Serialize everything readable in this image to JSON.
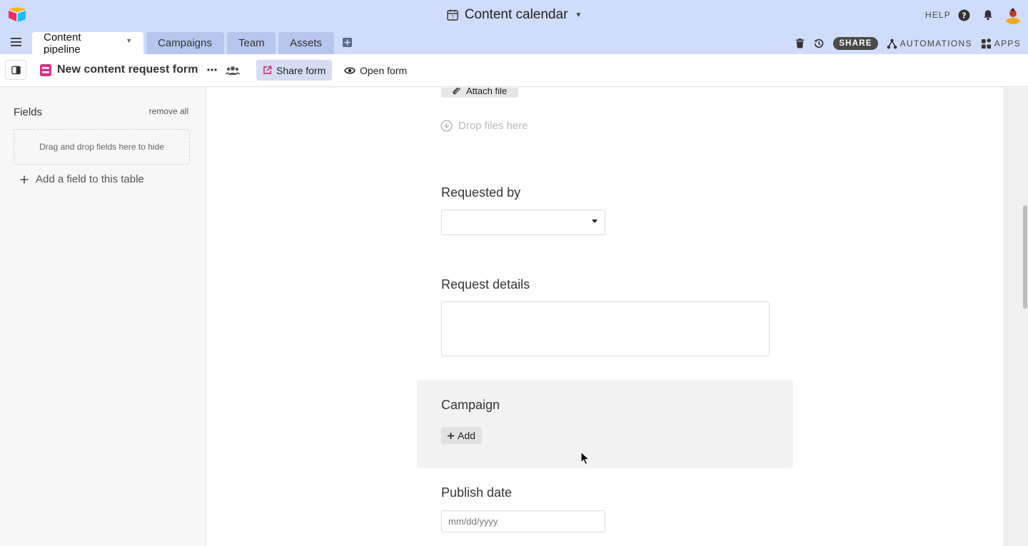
{
  "header": {
    "base_title": "Content calendar",
    "help_label": "HELP",
    "title_icon": "calendar-icon"
  },
  "tabs": [
    {
      "label": "Content pipeline",
      "active": true
    },
    {
      "label": "Campaigns",
      "active": false
    },
    {
      "label": "Team",
      "active": false
    },
    {
      "label": "Assets",
      "active": false
    }
  ],
  "toolbar": {
    "share_label": "SHARE",
    "automations_label": "AUTOMATIONS",
    "apps_label": "APPS"
  },
  "viewbar": {
    "view_name": "New content request form",
    "share_form_label": "Share form",
    "open_form_label": "Open form"
  },
  "sidebar": {
    "title": "Fields",
    "remove_all_label": "remove all",
    "dropzone_text": "Drag and drop fields here to hide",
    "add_field_label": "Add a field to this table"
  },
  "form": {
    "attach_label": "Attach file",
    "drop_files_label": "Drop files here",
    "requested_by_label": "Requested by",
    "request_details_label": "Request details",
    "campaign_label": "Campaign",
    "campaign_add_label": "Add",
    "publish_date_label": "Publish date",
    "publish_date_placeholder": "mm/dd/yyyy"
  },
  "colors": {
    "header_bg": "#cfdcfa",
    "tab_inactive_bg": "#b6c6ec",
    "share_form_bg": "#d6dcf3",
    "form_icon": "#d63384"
  }
}
